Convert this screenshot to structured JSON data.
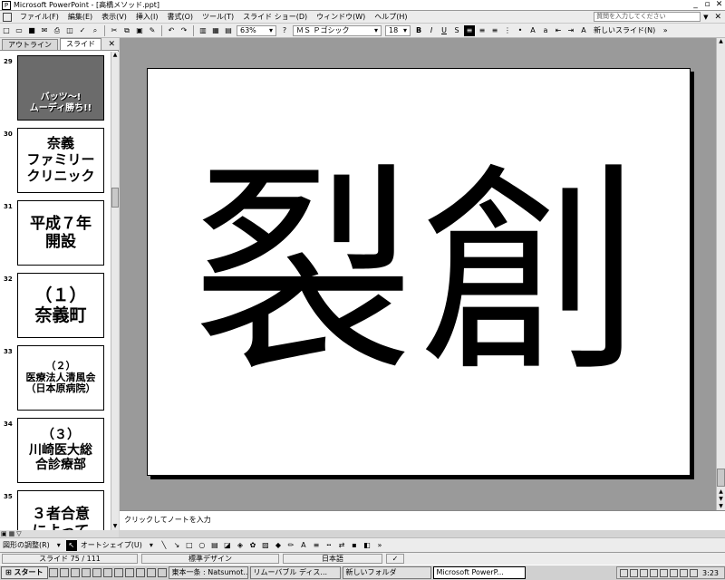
{
  "window": {
    "title": "Microsoft PowerPoint - [高橋メソッド.ppt]"
  },
  "menu": {
    "items": [
      "ファイル(F)",
      "編集(E)",
      "表示(V)",
      "挿入(I)",
      "書式(O)",
      "ツール(T)",
      "スライド ショー(D)",
      "ウィンドウ(W)",
      "ヘルプ(H)"
    ],
    "help_placeholder": "質問を入力してください"
  },
  "toolbar": {
    "zoom": "63%",
    "font_name": "ＭＳ Ｐゴシック",
    "font_size": "18",
    "bold": "B",
    "italic": "I",
    "underline": "U",
    "new_slide": "新しいスライド(N)"
  },
  "left_pane": {
    "tabs": [
      "アウトライン",
      "スライド"
    ],
    "slides": [
      {
        "num": "29",
        "lines": [
          "バッツ～!",
          "ムーディ勝ち!!"
        ],
        "photo": true
      },
      {
        "num": "30",
        "lines": [
          "奈義",
          "ファミリー",
          "クリニック"
        ],
        "size": 15
      },
      {
        "num": "31",
        "lines": [
          "平成７年",
          "開設"
        ],
        "size": 17
      },
      {
        "num": "32",
        "lines": [
          "（１）",
          "奈義町"
        ],
        "size": 19
      },
      {
        "num": "33",
        "lines": [
          "（２）",
          "医療法人清風会",
          "（日本原病院）"
        ],
        "size": 11
      },
      {
        "num": "34",
        "lines": [
          "（３）",
          "川崎医大総",
          "合診療部"
        ],
        "size": 14
      },
      {
        "num": "35",
        "lines": [
          "３者合意",
          "によって"
        ],
        "size": 16
      }
    ]
  },
  "slide": {
    "text": "裂創"
  },
  "notes": {
    "placeholder": "クリックしてノートを入力"
  },
  "drawing_toolbar": {
    "draw_label": "図形の調整(R)",
    "autoshape_label": "オートシェイプ(U)"
  },
  "status": {
    "slide_indicator": "スライド 75 / 111",
    "design": "標準デザイン",
    "language": "日本語"
  },
  "taskbar": {
    "start": "スタート",
    "tasks": [
      "東本一条 : Natsumot...",
      "リムーバブル ディス...",
      "新しいフォルダ",
      "Microsoft PowerP..."
    ],
    "active_task": 3,
    "clock": "3:23"
  }
}
